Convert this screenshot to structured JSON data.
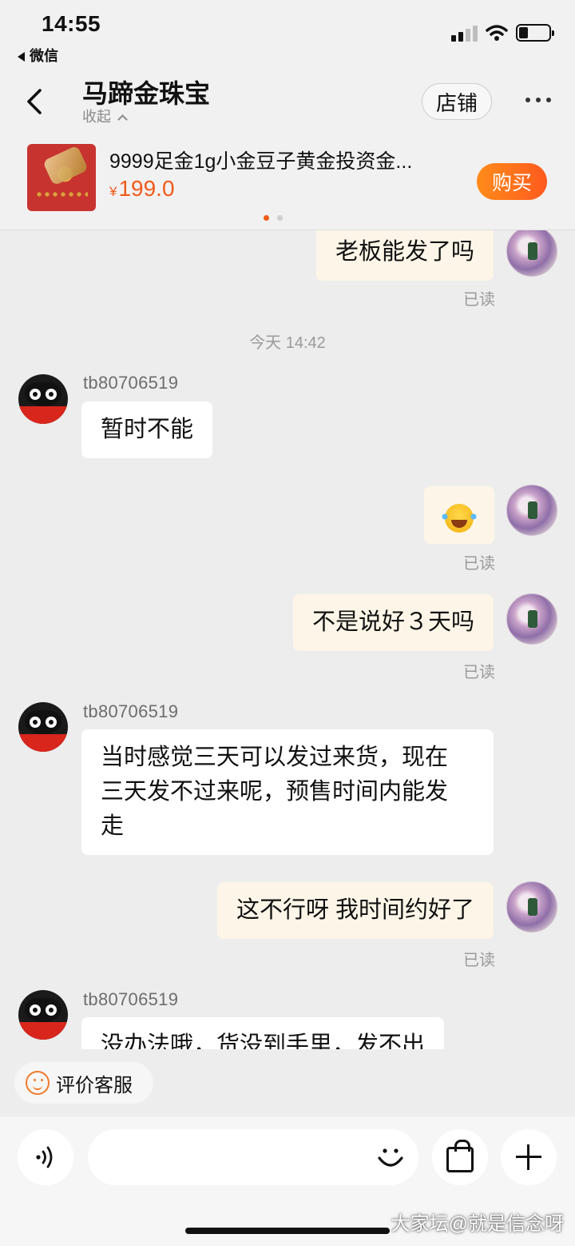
{
  "status_bar": {
    "time": "14:55",
    "back_app": "微信",
    "battery_level": 0.3
  },
  "header": {
    "shop_name": "马蹄金珠宝",
    "collapse_label": "收起",
    "store_button": "店铺"
  },
  "product": {
    "title": "9999足金1g小金豆子黄金投资金...",
    "currency": "¥",
    "price": "199.0",
    "buy_button": "购买",
    "carousel_page": 1,
    "carousel_total": 2
  },
  "chat": {
    "messages": [
      {
        "from": "self",
        "text": "老板能发了吗",
        "status": "已读"
      },
      {
        "time_separator": "今天 14:42"
      },
      {
        "from": "shop",
        "sender": "tb80706519",
        "text": "暂时不能"
      },
      {
        "from": "self",
        "emoji": "laughing-with-tears",
        "status": "已读"
      },
      {
        "from": "self",
        "text": "不是说好３天吗",
        "status": "已读"
      },
      {
        "from": "shop",
        "sender": "tb80706519",
        "lines": [
          "当时感觉三天可以发过来货，现在",
          "三天发不过来呢，预售时间内能发",
          "走"
        ]
      },
      {
        "from": "self",
        "text": "这不行呀 我时间约好了",
        "status": "已读"
      },
      {
        "from": "shop",
        "sender": "tb80706519",
        "text": "没办法哦，货没到手里，发不出"
      }
    ]
  },
  "quick_action": {
    "rate_service": "评价客服"
  },
  "input_bar": {
    "placeholder": ""
  },
  "watermark": "大家坛@就是信念呀",
  "colors": {
    "accent": "#f05a1a",
    "self_bubble": "#fdf6e8",
    "shop_bubble": "#ffffff",
    "background": "#ededed"
  }
}
